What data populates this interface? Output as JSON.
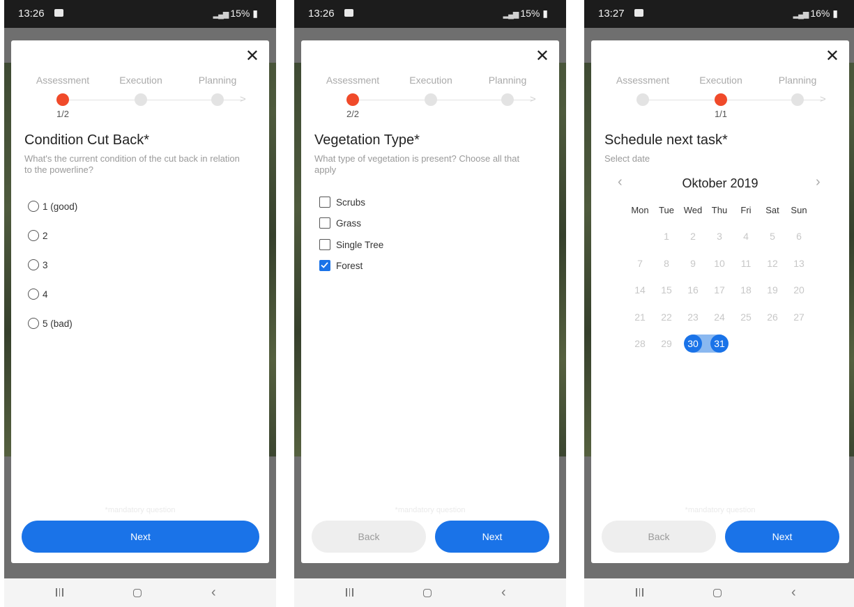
{
  "screens": [
    {
      "status": {
        "time": "13:26",
        "battery": "15%"
      },
      "steps": [
        "Assessment",
        "Execution",
        "Planning"
      ],
      "active_step": 0,
      "step_count": "1/2",
      "question": {
        "title": "Condition Cut Back*",
        "description": "What's the current condition of the cut back in relation to the powerline?"
      },
      "options": [
        "1 (good)",
        "2",
        "3",
        "4",
        "5 (bad)"
      ],
      "footer_note": "*mandatory question",
      "buttons": {
        "next": "Next"
      }
    },
    {
      "status": {
        "time": "13:26",
        "battery": "15%"
      },
      "steps": [
        "Assessment",
        "Execution",
        "Planning"
      ],
      "active_step": 0,
      "step_count": "2/2",
      "question": {
        "title": "Vegetation Type*",
        "description": "What type of vegetation is present? Choose all that apply"
      },
      "options": [
        {
          "label": "Scrubs",
          "checked": false
        },
        {
          "label": "Grass",
          "checked": false
        },
        {
          "label": "Single Tree",
          "checked": false
        },
        {
          "label": "Forest",
          "checked": true
        }
      ],
      "footer_note": "*mandatory question",
      "buttons": {
        "back": "Back",
        "next": "Next"
      }
    },
    {
      "status": {
        "time": "13:27",
        "battery": "16%"
      },
      "steps": [
        "Assessment",
        "Execution",
        "Planning"
      ],
      "active_step": 1,
      "step_count": "1/1",
      "question": {
        "title": "Schedule next task*",
        "description": "Select date"
      },
      "calendar": {
        "month": "Oktober 2019",
        "prev_icon": "‹",
        "next_icon": "›",
        "weekdays": [
          "Mon",
          "Tue",
          "Wed",
          "Thu",
          "Fri",
          "Sat",
          "Sun"
        ],
        "weeks": [
          [
            "",
            "1",
            "2",
            "3",
            "4",
            "5",
            "6"
          ],
          [
            "7",
            "8",
            "9",
            "10",
            "11",
            "12",
            "13"
          ],
          [
            "14",
            "15",
            "16",
            "17",
            "18",
            "19",
            "20"
          ],
          [
            "21",
            "22",
            "23",
            "24",
            "25",
            "26",
            "27"
          ],
          [
            "28",
            "29",
            "30",
            "31",
            "",
            "",
            ""
          ]
        ],
        "selected": [
          "30",
          "31"
        ]
      },
      "footer_note": "*mandatory question",
      "buttons": {
        "back": "Back",
        "next": "Next"
      }
    }
  ],
  "colors": {
    "accent": "#1a73e8",
    "active_step": "#f04a2a",
    "back_button": "#eeeeee"
  },
  "icons": {
    "close": "close-icon",
    "radio": "radio-icon",
    "checkbox": "checkbox-icon",
    "nav_recent": "recent-apps-icon",
    "nav_home": "home-icon",
    "nav_back": "back-icon",
    "gallery": "gallery-icon"
  },
  "nav_glyphs": {
    "back": "‹",
    "close": "✕"
  }
}
